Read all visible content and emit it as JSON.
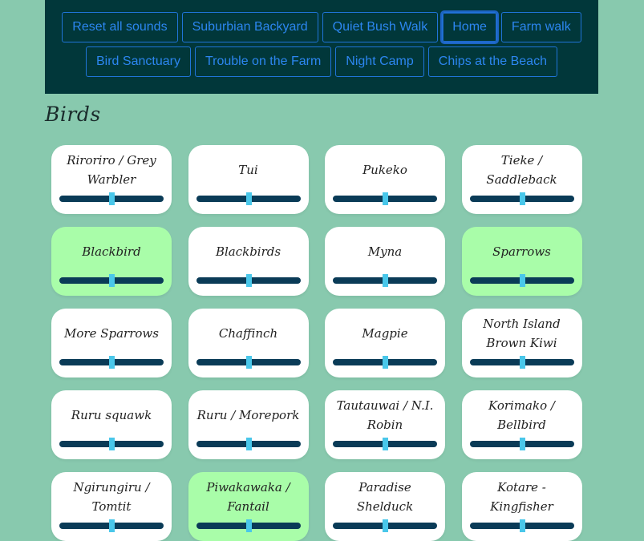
{
  "presets": {
    "row1": [
      "Reset all sounds",
      "Suburbian Backyard",
      "Quiet Bush Walk",
      "Home",
      "Farm walk"
    ],
    "row2": [
      "Bird Sanctuary",
      "Trouble on the Farm",
      "Night Camp",
      "Chips at the Beach"
    ],
    "active": "Home"
  },
  "section": {
    "title": "Birds"
  },
  "sounds": [
    {
      "label": "Riroriro / Grey Warbler",
      "volume": 0.5,
      "on": false
    },
    {
      "label": "Tui",
      "volume": 0.5,
      "on": false
    },
    {
      "label": "Pukeko",
      "volume": 0.5,
      "on": false
    },
    {
      "label": "Tieke / Saddleback",
      "volume": 0.5,
      "on": false
    },
    {
      "label": "Blackbird",
      "volume": 0.5,
      "on": true
    },
    {
      "label": "Blackbirds",
      "volume": 0.5,
      "on": false
    },
    {
      "label": "Myna",
      "volume": 0.5,
      "on": false
    },
    {
      "label": "Sparrows",
      "volume": 0.5,
      "on": true
    },
    {
      "label": "More Sparrows",
      "volume": 0.5,
      "on": false
    },
    {
      "label": "Chaffinch",
      "volume": 0.5,
      "on": false
    },
    {
      "label": "Magpie",
      "volume": 0.5,
      "on": false
    },
    {
      "label": "North Island Brown Kiwi",
      "volume": 0.5,
      "on": false
    },
    {
      "label": "Ruru squawk",
      "volume": 0.5,
      "on": false
    },
    {
      "label": "Ruru / Morepork",
      "volume": 0.5,
      "on": false
    },
    {
      "label": "Tautauwai / N.I. Robin",
      "volume": 0.5,
      "on": false
    },
    {
      "label": "Korimako / Bellbird",
      "volume": 0.5,
      "on": false
    },
    {
      "label": "Ngirungiru / Tomtit",
      "volume": 0.5,
      "on": false
    },
    {
      "label": "Piwakawaka / Fantail",
      "volume": 0.5,
      "on": true
    },
    {
      "label": "Paradise Shelduck",
      "volume": 0.5,
      "on": false
    },
    {
      "label": "Kotare - Kingfisher",
      "volume": 0.5,
      "on": false
    }
  ],
  "colors": {
    "background": "#88c9ae",
    "topbar": "#01373a",
    "button_text": "#2c86f0",
    "card": "#ffffff",
    "card_active": "#a9fda9",
    "slider_track": "#0a3b57",
    "slider_thumb": "#49c7ea"
  }
}
